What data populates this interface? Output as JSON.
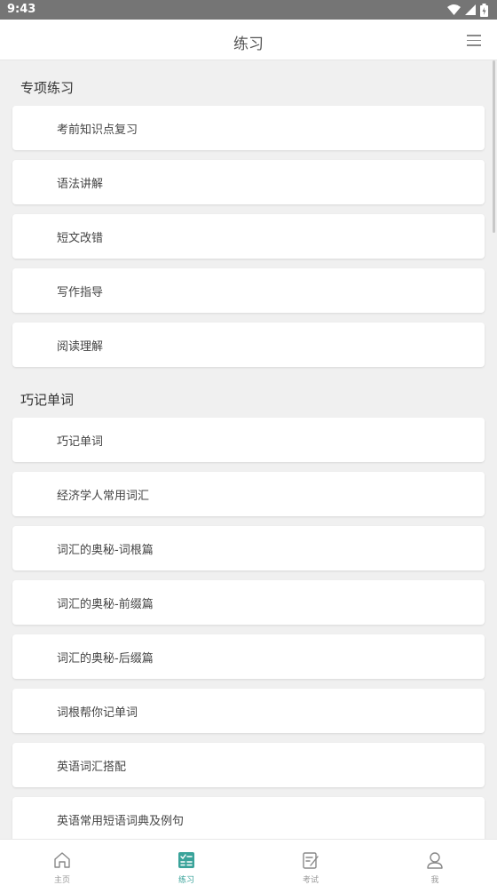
{
  "status_bar": {
    "time": "9:43"
  },
  "header": {
    "title": "练习"
  },
  "sections": [
    {
      "title": "专项练习",
      "items": [
        "考前知识点复习",
        "语法讲解",
        "短文改错",
        "写作指导",
        "阅读理解"
      ]
    },
    {
      "title": "巧记单词",
      "items": [
        "巧记单词",
        "经济学人常用词汇",
        "词汇的奥秘-词根篇",
        "词汇的奥秘-前缀篇",
        "词汇的奥秘-后缀篇",
        "词根帮你记单词",
        "英语词汇搭配",
        "英语常用短语词典及例句"
      ]
    }
  ],
  "tabs": [
    {
      "label": "主页",
      "icon": "home-icon"
    },
    {
      "label": "练习",
      "icon": "practice-icon",
      "active": true
    },
    {
      "label": "考试",
      "icon": "exam-icon"
    },
    {
      "label": "我",
      "icon": "user-icon"
    }
  ],
  "colors": {
    "accent": "#3aa39a",
    "status_bar": "#757575"
  }
}
